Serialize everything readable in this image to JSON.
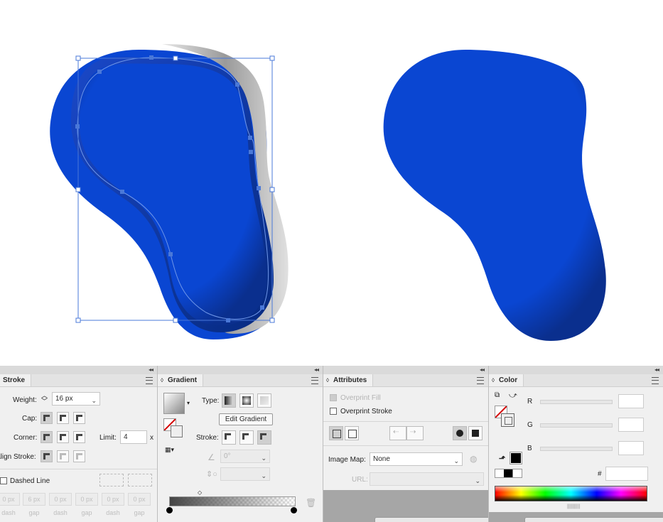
{
  "stroke_panel": {
    "tab": "Stroke",
    "weight_label": "Weight:",
    "weight_value": "16 px",
    "cap_label": "Cap:",
    "corner_label": "Corner:",
    "limit_label": "Limit:",
    "limit_value": "4",
    "limit_unit": "x",
    "align_label": "Align Stroke:",
    "dashed_line_label": "Dashed Line",
    "dash_fields": [
      {
        "value": "0 px",
        "label": "dash"
      },
      {
        "value": "6 px",
        "label": "gap"
      },
      {
        "value": "0 px",
        "label": "dash"
      },
      {
        "value": "0 px",
        "label": "gap"
      },
      {
        "value": "0 px",
        "label": "dash"
      },
      {
        "value": "0 px",
        "label": "gap"
      }
    ]
  },
  "gradient_panel": {
    "tab": "Gradient",
    "type_label": "Type:",
    "edit_gradient_label": "Edit Gradient",
    "stroke_label": "Stroke:",
    "angle_value": "0°"
  },
  "attributes_panel": {
    "tab": "Attributes",
    "overprint_fill_label": "Overprint Fill",
    "overprint_stroke_label": "Overprint Stroke",
    "image_map_label": "Image Map:",
    "image_map_value": "None",
    "url_label": "URL:"
  },
  "color_panel": {
    "tab": "Color",
    "r_label": "R",
    "g_label": "G",
    "b_label": "B",
    "hex_label": "#"
  },
  "colors": {
    "shape_blue": "#0a46d2",
    "panel_bg": "#f0f0f0",
    "selection": "#4a78d8"
  }
}
